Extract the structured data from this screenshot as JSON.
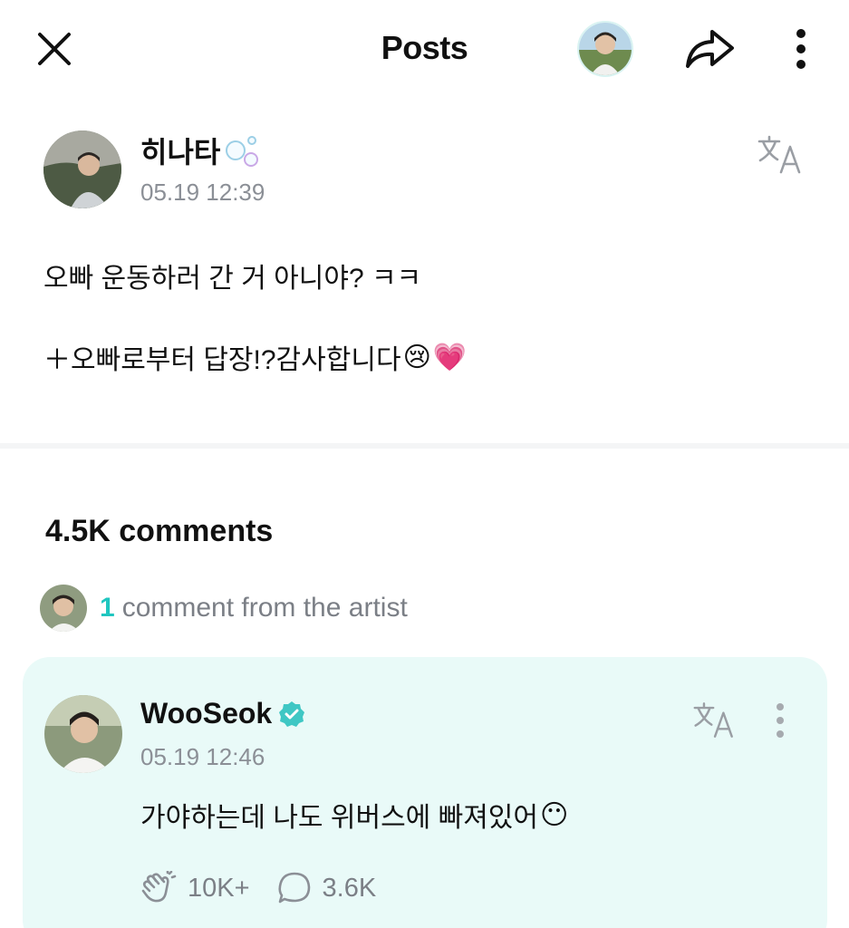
{
  "topbar": {
    "title": "Posts",
    "icons": [
      "close-icon",
      "artist-avatar",
      "share-icon",
      "more-vertical-icon"
    ]
  },
  "post": {
    "author": "히나타",
    "author_decoration_icon": "bubbles-icon",
    "time": "05.19 12:39",
    "line1": "오빠 운동하러 간 거 아니야? ㅋㅋ",
    "line2": "＋오빠로부터 답장!?감사합니다",
    "line2_emojis": [
      "😢",
      "💗"
    ],
    "translate_icon": "translate-icon"
  },
  "comments": {
    "count_label": "4.5K comments",
    "artist_count": "1",
    "artist_label": "comment from the artist"
  },
  "artist_comment": {
    "author": "WooSeok",
    "verified_icon": "verified-badge-icon",
    "time": "05.19 12:46",
    "text": "가야하는데 나도 위버스에 빠져있어",
    "text_emoji": "😶",
    "likes": "10K+",
    "replies": "3.6K",
    "background": "#e9faf8"
  },
  "colors": {
    "accent": "#20c6c0",
    "verified": "#3fc7c4",
    "muted_text": "#8b8f96"
  }
}
